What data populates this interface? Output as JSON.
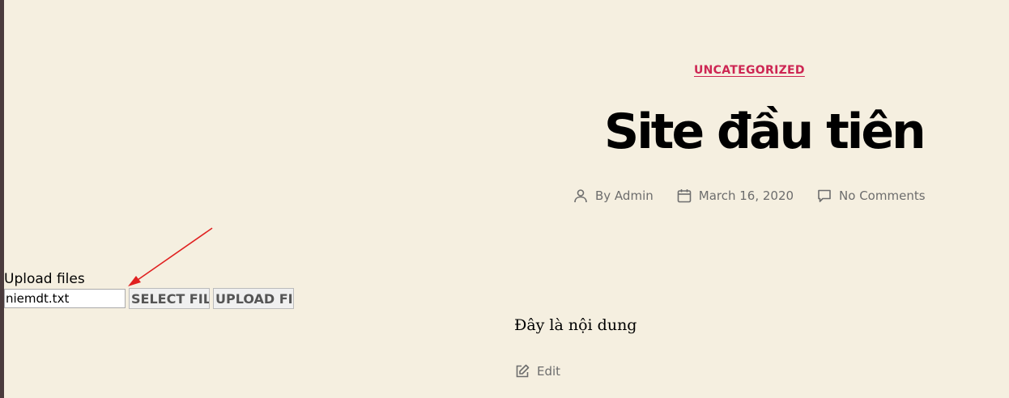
{
  "post": {
    "category": "UNCATEGORIZED",
    "title": "Site đầu tiên",
    "meta": {
      "author": "By Admin",
      "date": "March 16, 2020",
      "comments": "No Comments"
    },
    "content": "Đây là nội dung",
    "edit_label": "Edit"
  },
  "upload": {
    "label": "Upload files",
    "file_value": "niemdt.txt",
    "select_button": "SELECT FILE",
    "upload_button": "UPLOAD FILE"
  },
  "colors": {
    "background": "#f5efe0",
    "accent": "#cd2653",
    "meta_text": "#6d6d6d",
    "annotation_arrow": "#e02020"
  },
  "icons": {
    "author": "user-icon",
    "date": "calendar-icon",
    "comments": "comment-icon",
    "edit": "edit-icon"
  }
}
